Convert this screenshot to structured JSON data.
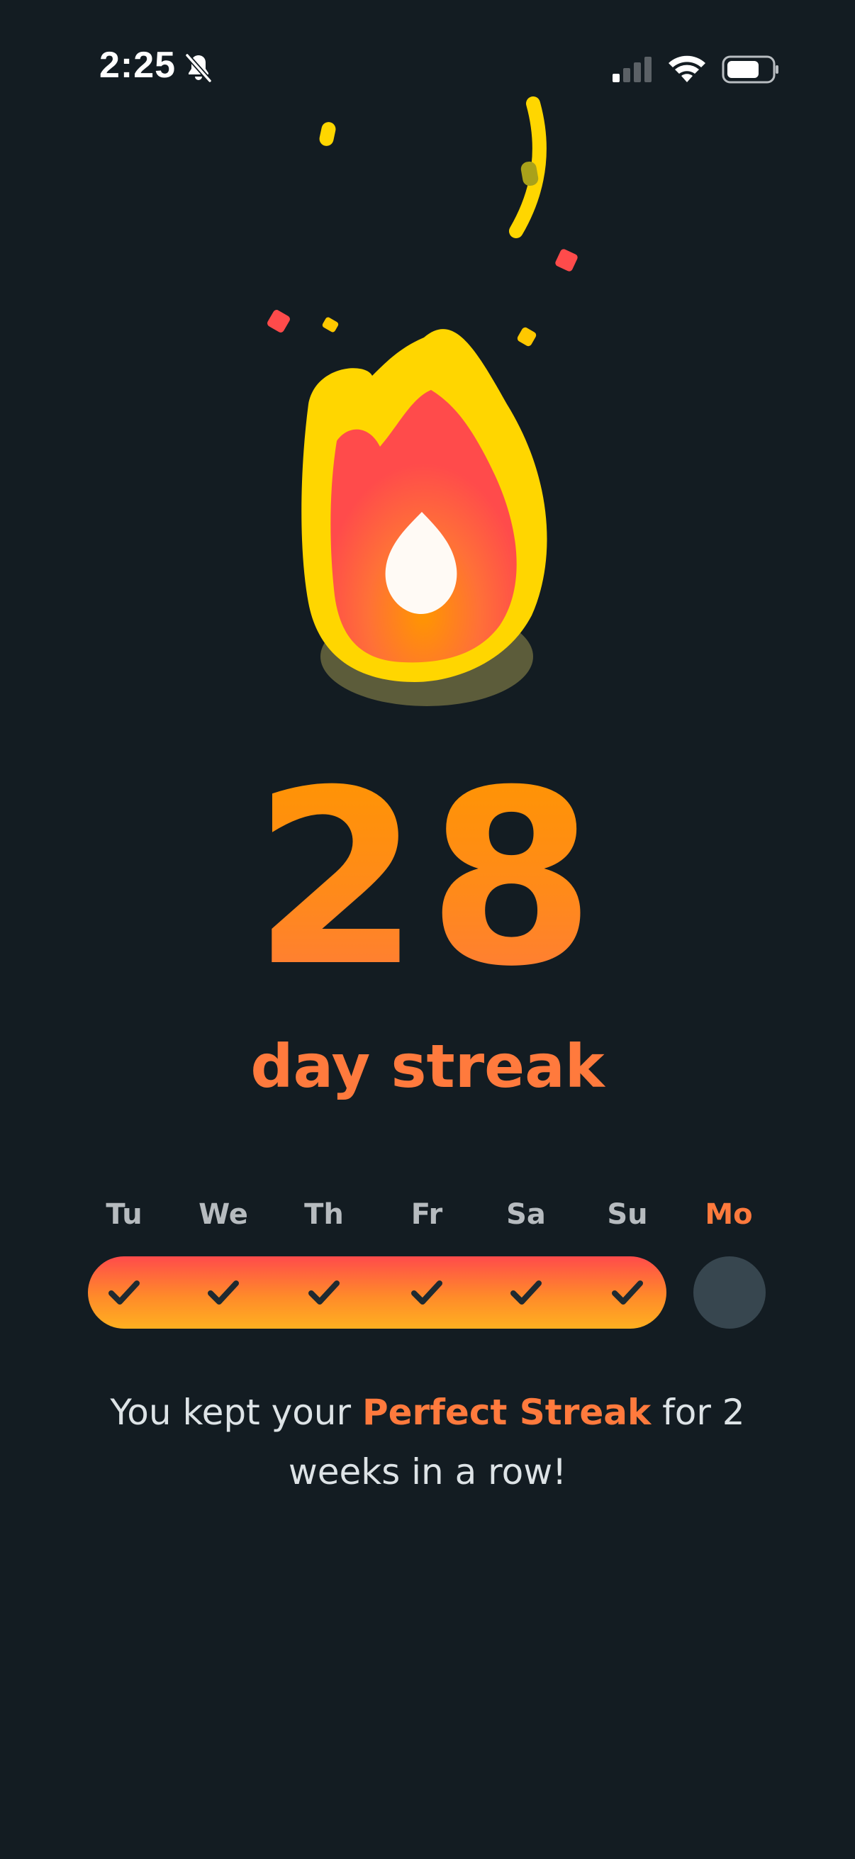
{
  "status_bar": {
    "time": "2:25",
    "icons": [
      "bell-slash-icon",
      "cellular-signal-icon",
      "wifi-icon",
      "battery-icon"
    ]
  },
  "illustration": {
    "icon": "fire-icon",
    "colors": {
      "outer": "#ffd600",
      "inner": "#ff4b4b",
      "glow": "#ff9600",
      "core": "#ffffff"
    }
  },
  "streak": {
    "count": "28",
    "label": "day streak",
    "gradient_top": "#ff9600",
    "gradient_bottom": "#ff7a3d"
  },
  "week": {
    "days": [
      {
        "label": "Tu",
        "completed": true
      },
      {
        "label": "We",
        "completed": true
      },
      {
        "label": "Th",
        "completed": true
      },
      {
        "label": "Fr",
        "completed": true
      },
      {
        "label": "Sa",
        "completed": true
      },
      {
        "label": "Su",
        "completed": true
      },
      {
        "label": "Mo",
        "completed": false,
        "today": true
      }
    ],
    "accent": "#ff7a3d",
    "pending_color": "#37464f"
  },
  "message": {
    "prefix": "You kept your ",
    "highlight": "Perfect Streak",
    "suffix": " for 2 weeks in a row!"
  },
  "colors": {
    "background": "#131c22",
    "text": "#dde3e6"
  }
}
